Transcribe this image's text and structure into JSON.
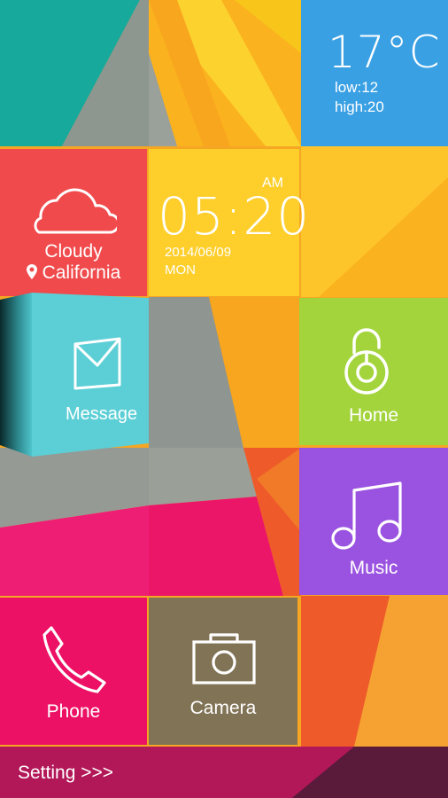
{
  "weather": {
    "temp": "17°C",
    "low": "low:12",
    "high": "high:20"
  },
  "location": {
    "condition": "Cloudy",
    "city": "California"
  },
  "clock": {
    "time": "05:20",
    "ampm": "AM",
    "date": "2014/06/09",
    "day": "MON"
  },
  "tiles": {
    "message": "Message",
    "home": "Home",
    "music": "Music",
    "phone": "Phone",
    "camera": "Camera"
  },
  "footer": {
    "setting": "Setting >>>"
  },
  "colors": {
    "teal": "#17a99b",
    "sky_blue": "#3aa0e4",
    "red": "#f04a4c",
    "yellow": "#fece2a",
    "lime": "#a3d43c",
    "purple": "#9a52e0",
    "magenta": "#ec1165",
    "khaki": "#817356",
    "cyan": "#5ccfd6"
  },
  "icons": [
    "cloud-icon",
    "location-pin-icon",
    "envelope-icon",
    "padlock-icon",
    "music-note-icon",
    "phone-icon",
    "camera-icon"
  ]
}
